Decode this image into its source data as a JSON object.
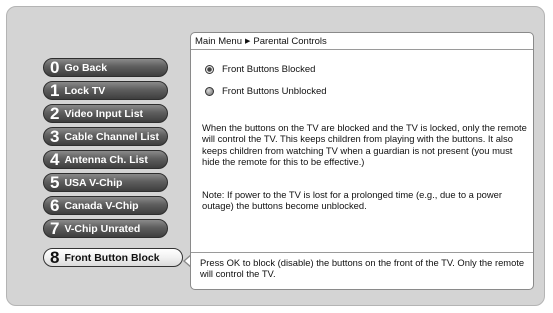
{
  "breadcrumb": {
    "root": "Main Menu",
    "current": "Parental Controls"
  },
  "menu": [
    {
      "num": "0",
      "label": "Go Back"
    },
    {
      "num": "1",
      "label": "Lock TV"
    },
    {
      "num": "2",
      "label": "Video Input List"
    },
    {
      "num": "3",
      "label": "Cable Channel List"
    },
    {
      "num": "4",
      "label": "Antenna Ch. List"
    },
    {
      "num": "5",
      "label": "USA V-Chip"
    },
    {
      "num": "6",
      "label": "Canada V-Chip"
    },
    {
      "num": "7",
      "label": "V-Chip Unrated"
    },
    {
      "num": "8",
      "label": "Front Button Block",
      "selected": true
    }
  ],
  "options": [
    {
      "label": "Front Buttons Blocked",
      "checked": true
    },
    {
      "label": "Front Buttons Unblocked",
      "checked": false
    }
  ],
  "description": {
    "p1": "When the buttons on the TV are blocked and the TV is locked, only the remote will control the TV. This keeps children from playing with the buttons. It also keeps children from watching TV when a guardian is not present (you must hide the remote for this to be effective.)",
    "p2": "Note: If power to the TV is lost for a prolonged time (e.g., due to a power outage) the buttons become unblocked."
  },
  "footer": "Press OK to block (disable) the buttons on the front of the TV. Only the remote will control the TV.",
  "colors": {
    "screen_bg": "#d4d4d4",
    "button_dark": "#4a4a4a",
    "button_selected": "#f1f1f1"
  }
}
